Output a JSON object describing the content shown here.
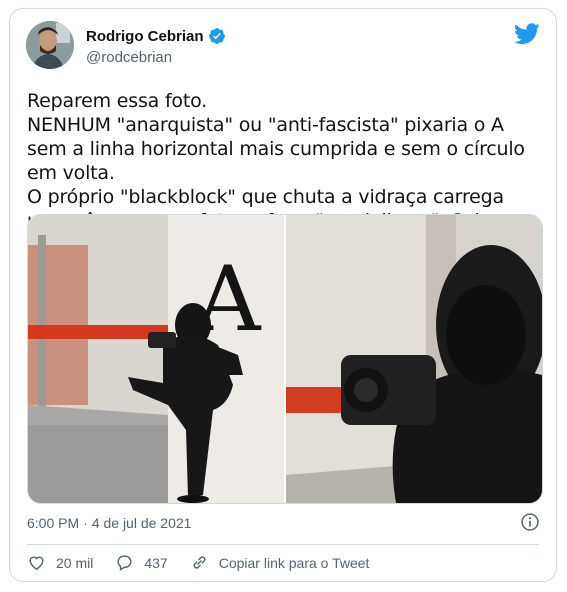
{
  "tweet": {
    "display_name": "Rodrigo Cebrian",
    "handle": "@rodcebrian",
    "text": "Reparem essa foto.\nNENHUM \"anarquista\" ou \"anti-fascista\" pixaria o A sem a linha horizontal mais cumprida e sem o círculo em volta.\nO próprio \"blackblock\" que chuta a vidraça carrega uma câmera para fotografar o \"vandalismo\". Sei.",
    "time": "6:00 PM",
    "separator": "·",
    "date": "4 de jul de 2021",
    "graffiti_letter": "A"
  },
  "actions": {
    "likes": "20 mil",
    "replies": "437",
    "copy_link": "Copiar link para o Tweet"
  },
  "icons": {
    "verified": "verified-badge-icon",
    "logo": "twitter-bird-icon",
    "info": "info-icon",
    "like": "heart-icon",
    "reply": "reply-bubble-icon",
    "link": "link-icon"
  },
  "colors": {
    "brand": "#1d9bf0",
    "text": "#0f1419",
    "secondary": "#536471",
    "border": "#cfd9de"
  }
}
